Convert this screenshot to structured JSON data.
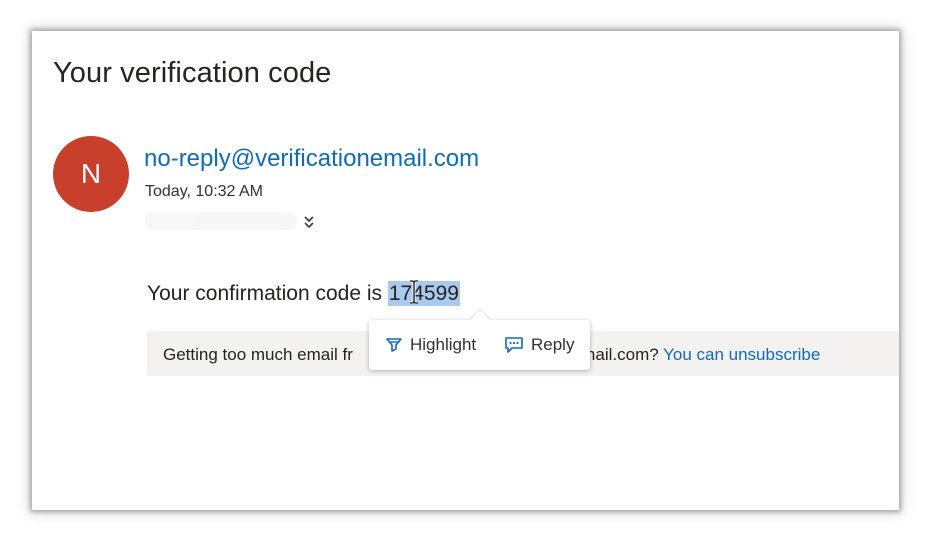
{
  "email": {
    "subject": "Your verification code",
    "sender_initial": "N",
    "sender": "no-reply@verificationemail.com",
    "date": "Today, 10:32 AM",
    "body_prefix": "Your confirmation code is ",
    "code": "174599"
  },
  "unsubscribe": {
    "text_before": "Getting too much email fr",
    "text_after": "nail.com? ",
    "link": "You can unsubscribe"
  },
  "selection_popup": {
    "highlight_label": "Highlight",
    "reply_label": "Reply"
  },
  "icons": {
    "expand": "double-chevron-down-icon",
    "highlight": "highlighter-icon",
    "reply": "comment-reply-icon",
    "cursor": "text-cursor-icon"
  },
  "colors": {
    "accent": "#0f6cbd",
    "avatar": "#c8402b",
    "selection": "#a9c9ee"
  }
}
